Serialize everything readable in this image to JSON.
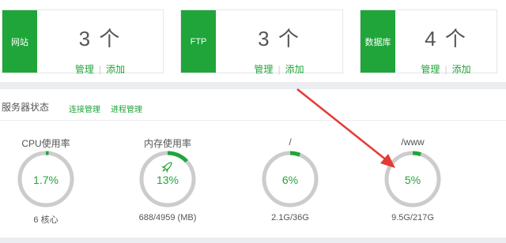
{
  "stats": [
    {
      "tag": "网站",
      "count": "3 个",
      "manage": "管理",
      "add": "添加"
    },
    {
      "tag": "FTP",
      "count": "3 个",
      "manage": "管理",
      "add": "添加"
    },
    {
      "tag": "数据库",
      "count": "4 个",
      "manage": "管理",
      "add": "添加"
    }
  ],
  "server_status": {
    "title": "服务器状态",
    "links": {
      "connections": "连接管理",
      "processes": "进程管理"
    }
  },
  "gauges": [
    {
      "label": "CPU使用率",
      "value": "1.7%",
      "percent": 1.7,
      "sub": "6 核心"
    },
    {
      "label": "内存使用率",
      "value": "13%",
      "percent": 13,
      "sub": "688/4959 (MB)",
      "icon": "rocket-icon"
    },
    {
      "label": "/",
      "value": "6%",
      "percent": 6,
      "sub": "2.1G/36G"
    },
    {
      "label": "/www",
      "value": "5%",
      "percent": 5,
      "sub": "9.5G/217G"
    }
  ],
  "colors": {
    "accent": "#20a53a",
    "track": "#cccccc",
    "arrow": "#e53935"
  }
}
